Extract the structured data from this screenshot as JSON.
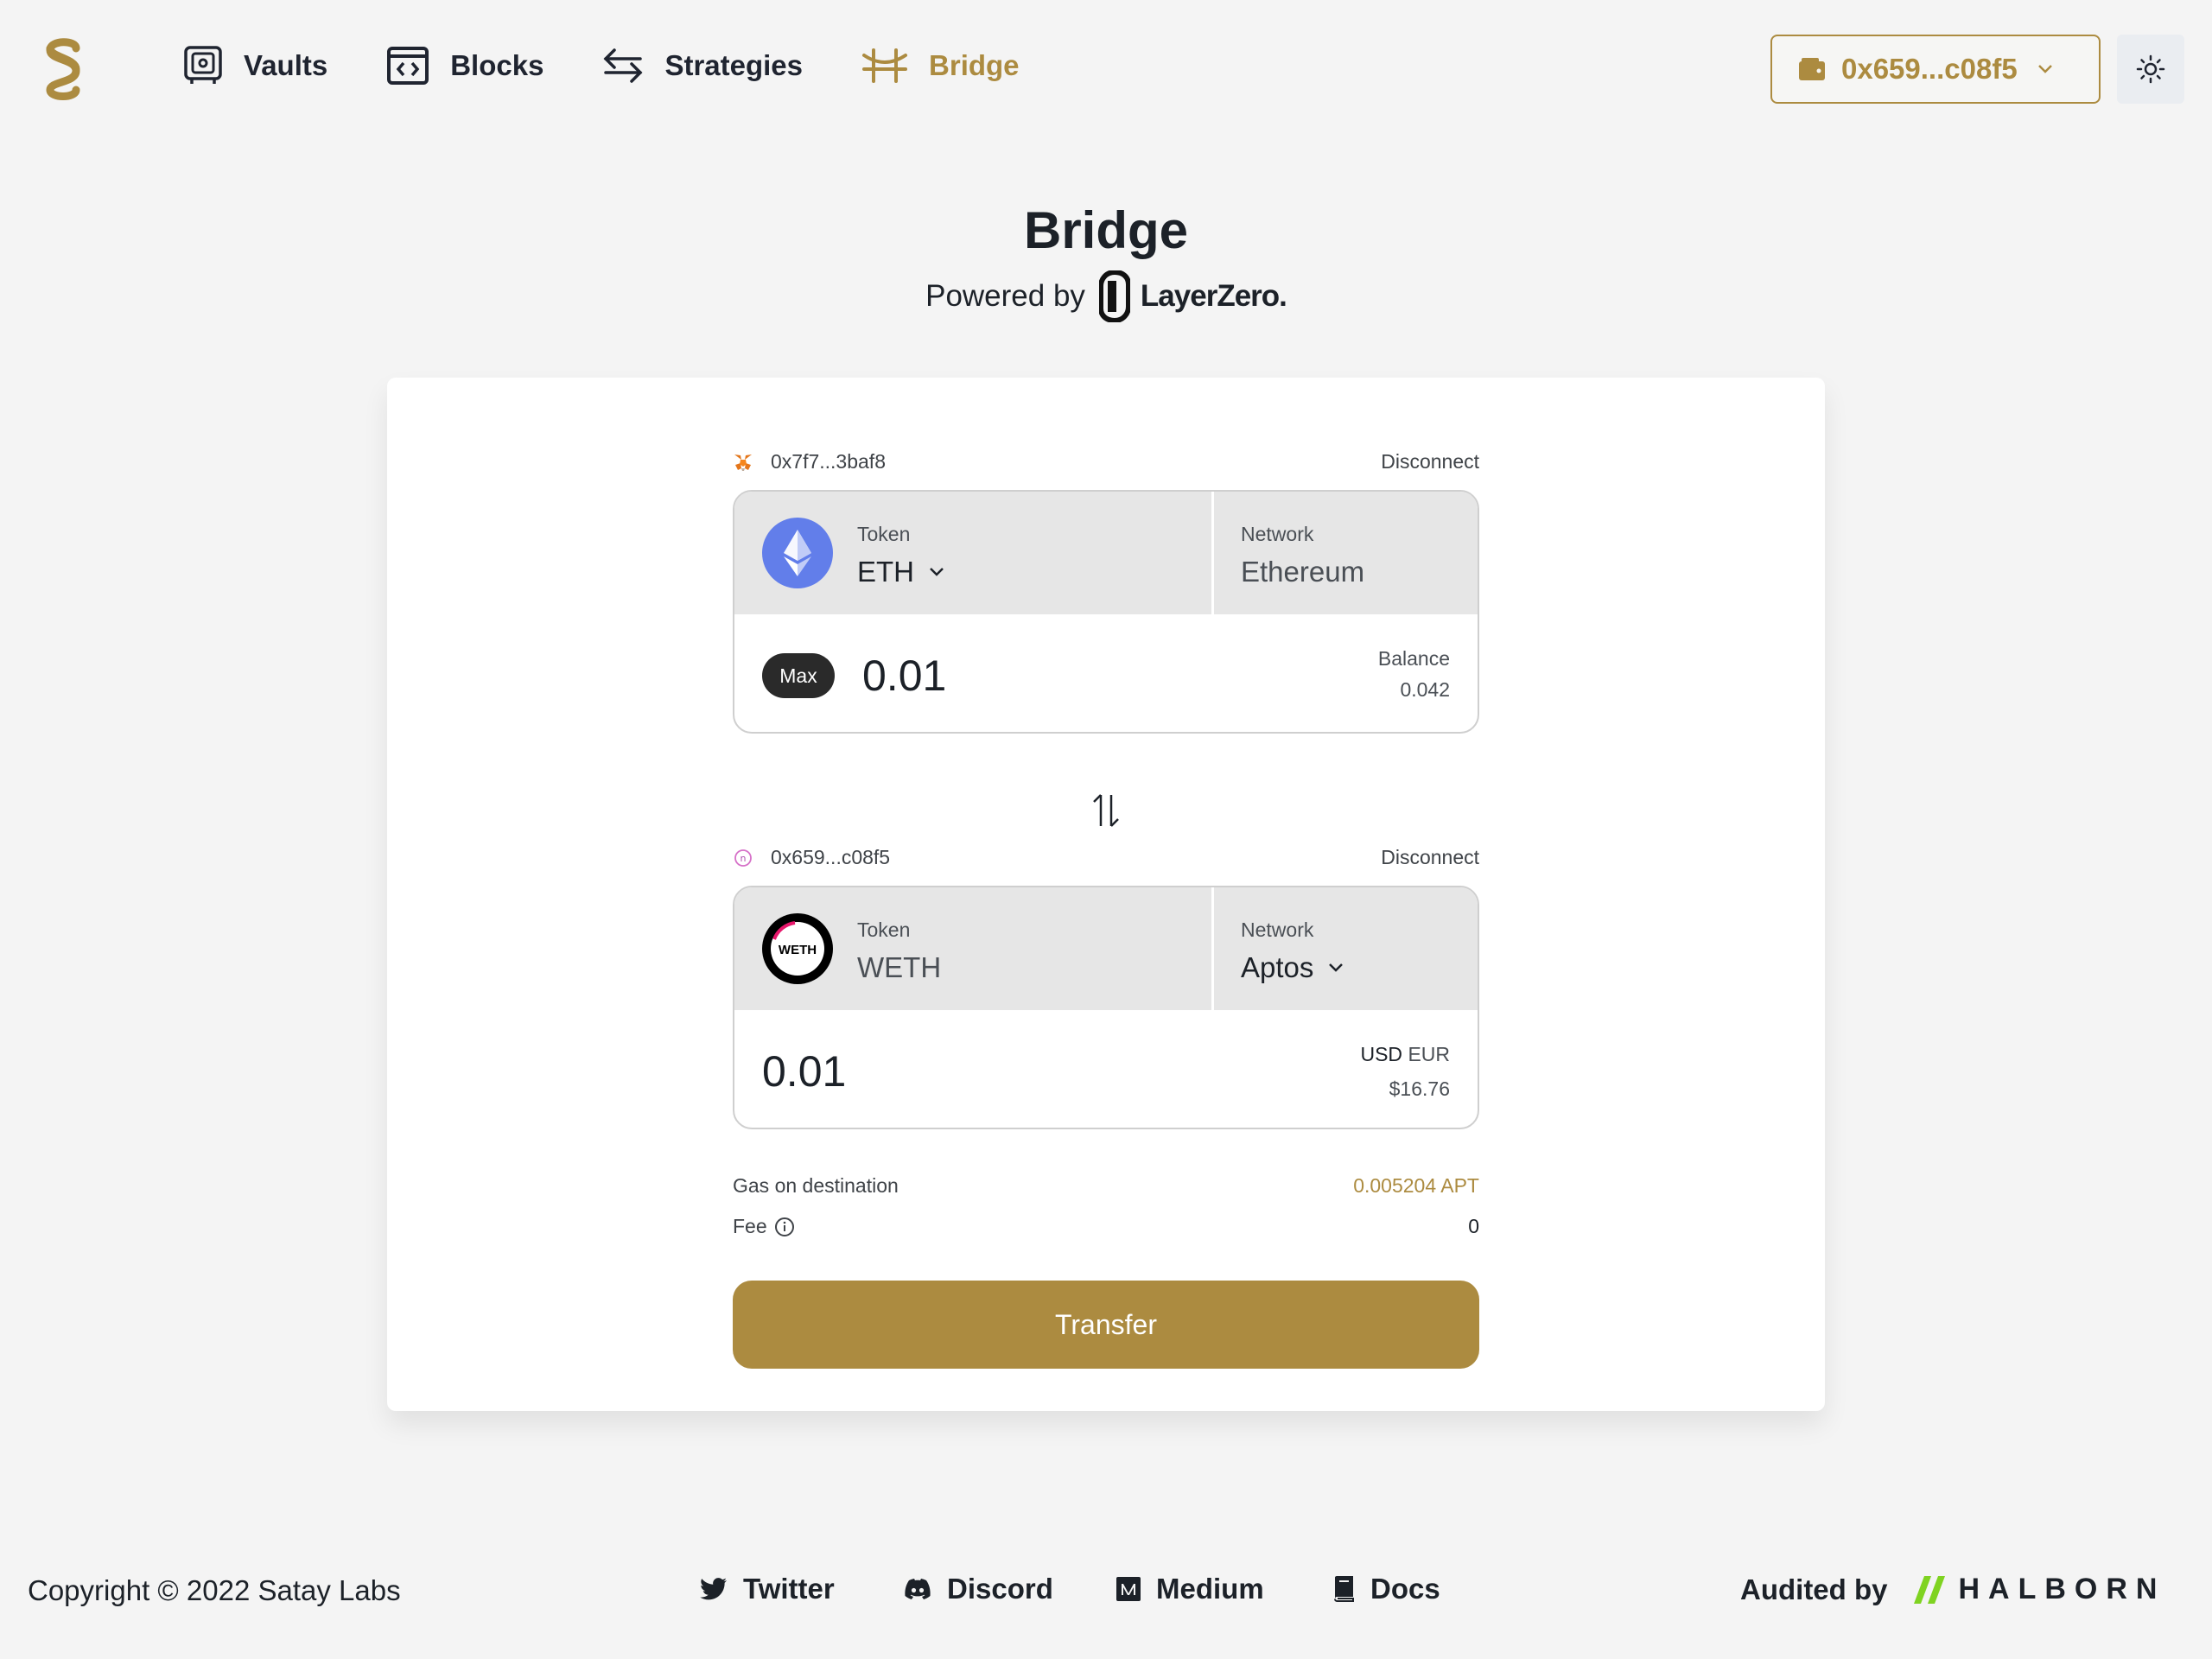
{
  "nav": {
    "items": [
      {
        "label": "Vaults"
      },
      {
        "label": "Blocks"
      },
      {
        "label": "Strategies"
      },
      {
        "label": "Bridge"
      }
    ]
  },
  "wallet": {
    "address": "0x659...c08f5"
  },
  "page": {
    "title": "Bridge",
    "powered_by": "Powered by",
    "partner": "LayerZero."
  },
  "source": {
    "wallet_address": "0x7f7...3baf8",
    "disconnect": "Disconnect",
    "token_label": "Token",
    "token": "ETH",
    "network_label": "Network",
    "network": "Ethereum",
    "max_label": "Max",
    "amount": "0.01",
    "balance_label": "Balance",
    "balance": "0.042"
  },
  "destination": {
    "wallet_address": "0x659...c08f5",
    "disconnect": "Disconnect",
    "token_label": "Token",
    "token": "WETH",
    "token_icon_text": "WETH",
    "network_label": "Network",
    "network": "Aptos",
    "amount": "0.01",
    "currency_selected": "USD",
    "currency_other": "EUR",
    "fiat_value": "$16.76"
  },
  "summary": {
    "gas_label": "Gas on destination",
    "gas_value": "0.005204 APT",
    "fee_label": "Fee",
    "fee_value": "0"
  },
  "actions": {
    "transfer": "Transfer"
  },
  "footer": {
    "copyright": "Copyright © 2022 Satay Labs",
    "links": [
      {
        "label": "Twitter"
      },
      {
        "label": "Discord"
      },
      {
        "label": "Medium"
      },
      {
        "label": "Docs"
      }
    ],
    "audited_by": "Audited by",
    "auditor": "HALBORN"
  },
  "colors": {
    "accent": "#ac8b40",
    "eth": "#627eea",
    "halborn": "#7fd321"
  }
}
